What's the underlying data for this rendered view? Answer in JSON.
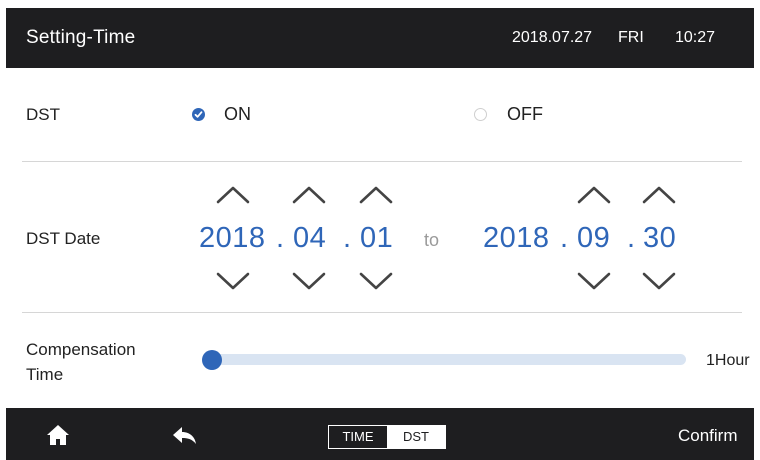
{
  "header": {
    "title": "Setting-Time",
    "date": "2018.07.27",
    "weekday": "FRI",
    "time": "10:27"
  },
  "dst": {
    "label": "DST",
    "on_label": "ON",
    "off_label": "OFF",
    "selected": "ON"
  },
  "dst_date": {
    "label": "DST Date",
    "separator": ".",
    "to_label": "to",
    "start": {
      "year": "2018",
      "month": "04",
      "day": "01"
    },
    "end": {
      "year": "2018",
      "month": "09",
      "day": "30"
    }
  },
  "compensation": {
    "label_line1": "Compensation",
    "label_line2": "Time",
    "value": "1Hour",
    "slider_fraction": 0
  },
  "footer": {
    "tab_time": "TIME",
    "tab_dst": "DST",
    "active_tab": "DST",
    "confirm_label": "Confirm"
  },
  "icons": {
    "home": "home-icon",
    "back": "back-arrow-icon",
    "up": "chevron-up-icon",
    "down": "chevron-down-icon"
  },
  "colors": {
    "accent": "#2f66b8",
    "bar": "#1e1e20",
    "track": "#d9e4f2"
  }
}
